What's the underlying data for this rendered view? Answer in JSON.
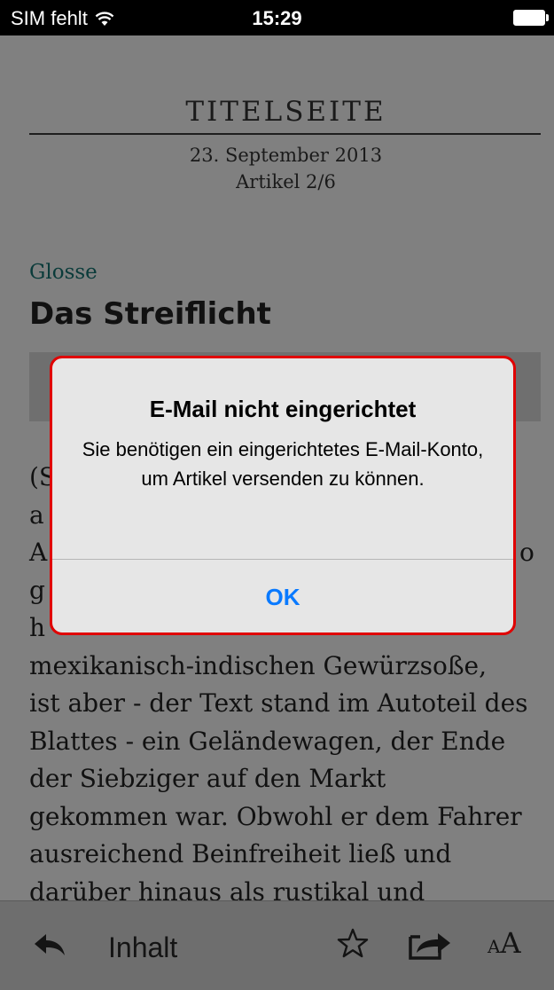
{
  "status_bar": {
    "carrier": "SIM fehlt",
    "time": "15:29",
    "wifi_icon": "wifi-icon",
    "battery_icon": "battery-icon"
  },
  "article": {
    "section": "TITELSEITE",
    "date": "23. September 2013",
    "position": "Artikel 2/6",
    "kicker": "Glosse",
    "headline": "Das Streiflicht",
    "body_lines": [
      "(S",
      "a",
      "A",
      "g",
      "h",
      "mexikanisch-indischen Gewürzsoße,",
      "ist aber - der Text stand im Autoteil des",
      "Blattes - ein Geländewagen, der Ende",
      "der Siebziger auf den Markt",
      "gekommen war. Obwohl er dem Fahrer",
      "ausreichend Beinfreiheit ließ und",
      "darüber hinaus als rustikal und"
    ],
    "partial_right_char": "o"
  },
  "alert": {
    "title": "E-Mail nicht eingerichtet",
    "message": "Sie benötigen ein eingerichtetes E-Mail-Konto, um Artikel versenden zu können.",
    "ok_label": "OK"
  },
  "toolbar": {
    "contents_label": "Inhalt",
    "font_small": "A",
    "font_large": "A",
    "icons": [
      "back-arrow-icon",
      "star-icon",
      "share-icon",
      "font-size-icon"
    ]
  },
  "colors": {
    "alert_highlight": "#e00000",
    "link_blue": "#0a7aff",
    "kicker_teal": "#0a3b3a"
  }
}
